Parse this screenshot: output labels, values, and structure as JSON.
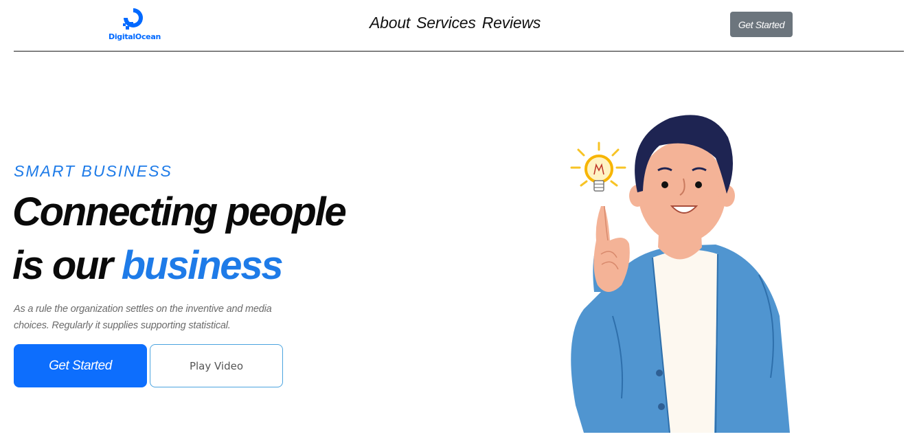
{
  "header": {
    "logo_text": "DigitalOcean",
    "nav": [
      "About",
      "Services",
      "Reviews"
    ],
    "cta_label": "Get Started"
  },
  "hero": {
    "eyebrow": "SMART BUSINESS",
    "headline_line1": "Connecting people",
    "headline_line2_prefix": "is our",
    "headline_line2_accent": "business",
    "description": "As a rule the organization settles on the inventive and media choices. Regularly it supplies supporting statistical.",
    "primary_button": "Get Started",
    "secondary_button": "Play Video"
  },
  "colors": {
    "accent": "#1e7be8",
    "primary_button": "#0d6efd",
    "header_button": "#6c757d",
    "logo": "#0069ff"
  },
  "icons": [
    "digitalocean-logo-icon",
    "lightbulb-icon",
    "man-pointing-illustration"
  ]
}
